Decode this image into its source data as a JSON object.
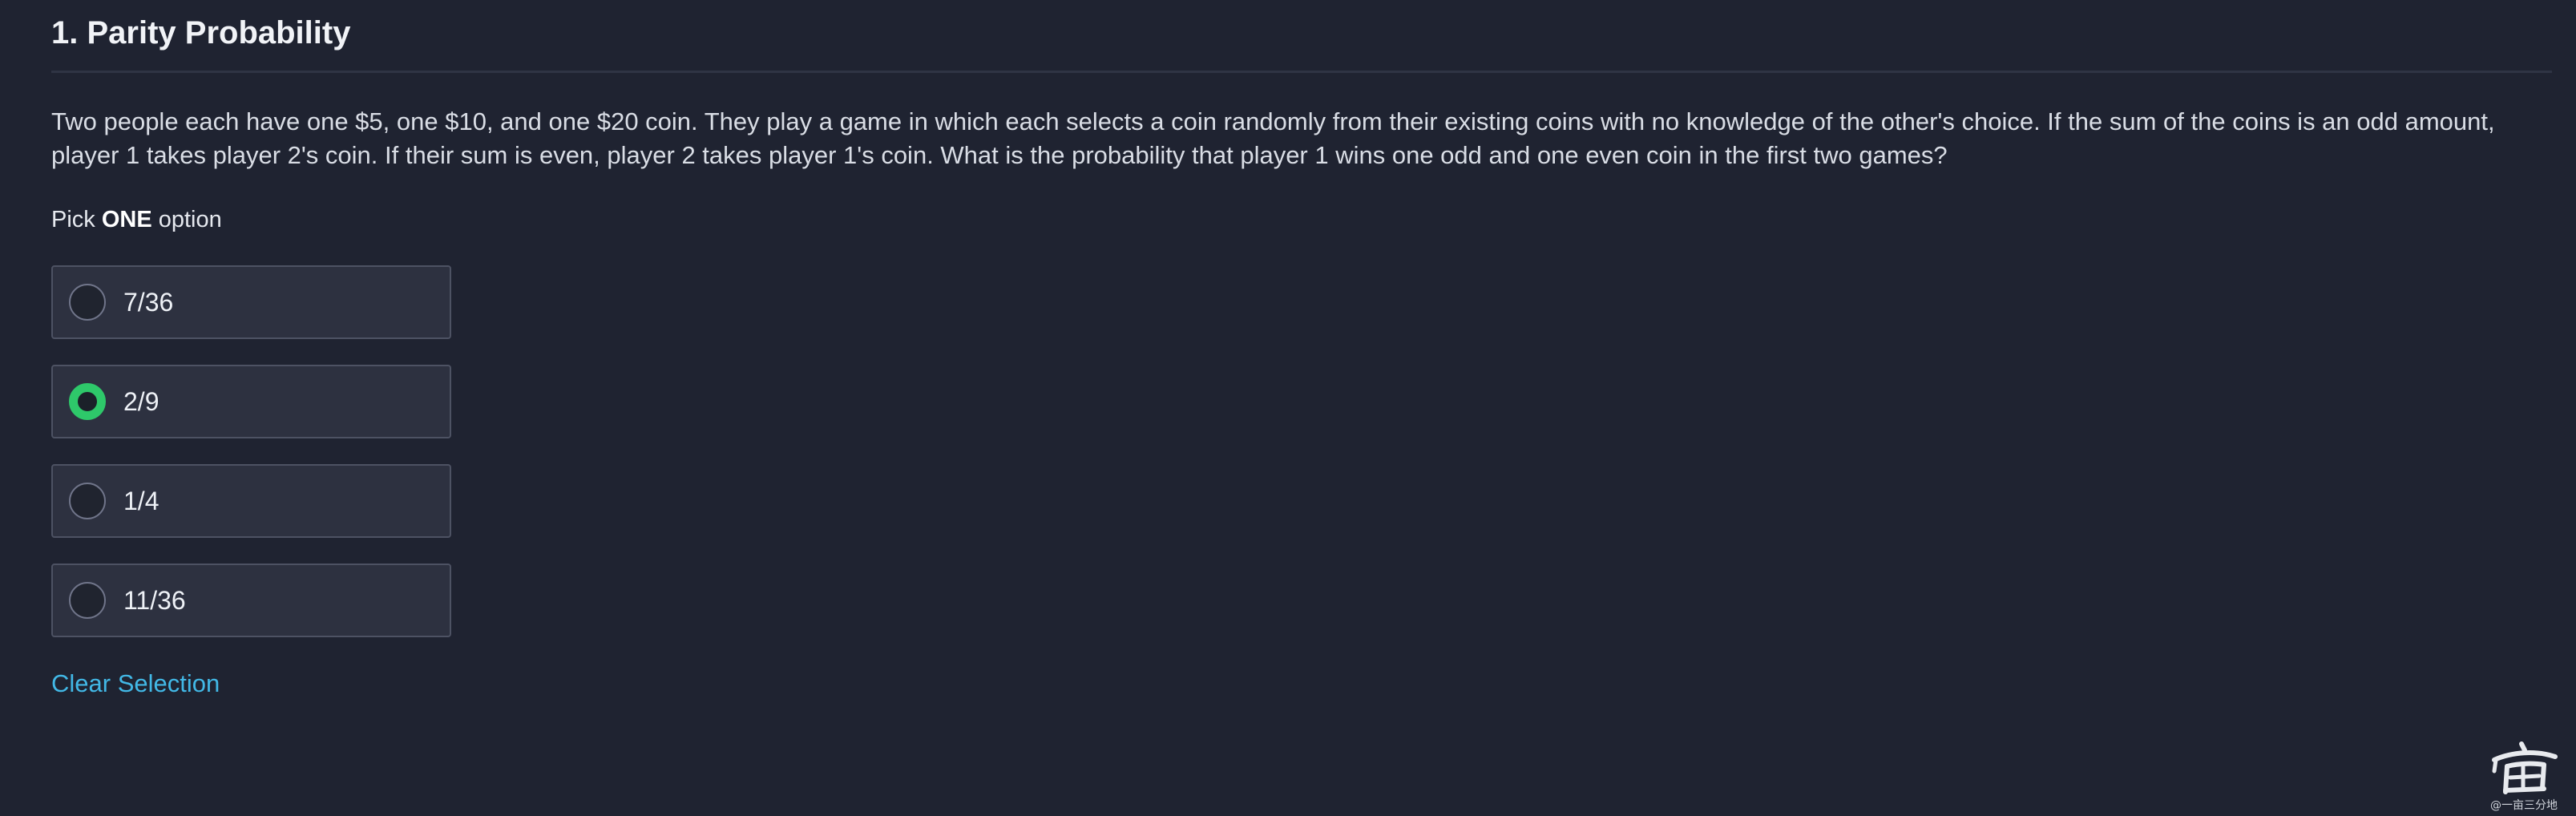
{
  "title": "1. Parity Probability",
  "question": "Two people each have one $5, one $10, and one $20 coin. They play a game in which each selects a coin randomly from their existing coins with no knowledge of the other's choice. If the sum of the coins is an odd amount, player 1 takes player 2's coin.  If their sum is even, player 2 takes player 1's coin. What is the probability that player 1 wins one odd and one even coin in the first two games?",
  "pick": {
    "prefix": "Pick ",
    "emphasis": "ONE",
    "suffix": " option"
  },
  "options": [
    {
      "label": "7/36",
      "selected": false
    },
    {
      "label": "2/9",
      "selected": true
    },
    {
      "label": "1/4",
      "selected": false
    },
    {
      "label": "11/36",
      "selected": false
    }
  ],
  "clear_label": "Clear Selection",
  "watermark": {
    "text": "@一亩三分地"
  },
  "colors": {
    "background": "#1f2331",
    "selected_radio": "#2ec86a",
    "link": "#42b8e6"
  }
}
